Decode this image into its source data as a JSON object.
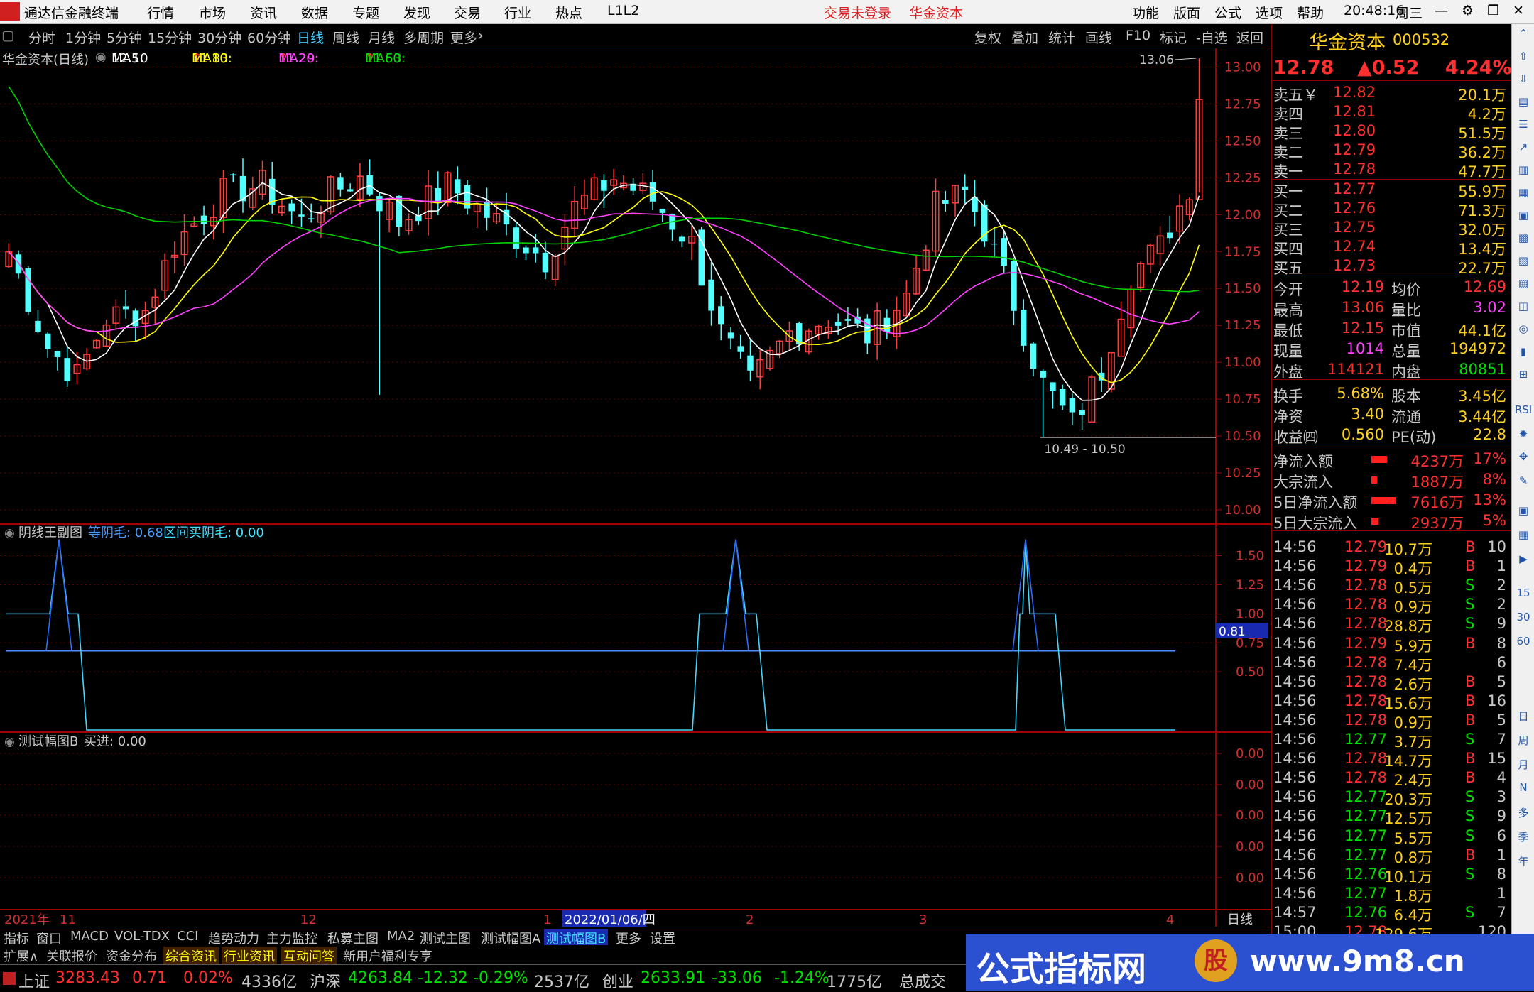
{
  "menubar": {
    "app_title": "通达信金融终端",
    "items": [
      "行情",
      "市场",
      "资讯",
      "数据",
      "专题",
      "发现",
      "交易",
      "行业",
      "热点",
      "L1L2"
    ],
    "notice": "交易未登录",
    "stock_name": "华金资本",
    "right_items": [
      "功能",
      "版面",
      "公式",
      "选项",
      "帮助"
    ],
    "time": "20:48:16",
    "weekday": "周三"
  },
  "periodbar": {
    "periods": [
      "分时",
      "1分钟",
      "5分钟",
      "15分钟",
      "30分钟",
      "60分钟",
      "日线",
      "周线",
      "月线",
      "多周期",
      "更多"
    ],
    "active": "日线",
    "right_tools": [
      "复权",
      "叠加",
      "统计",
      "画线",
      "F10",
      "标记",
      "-自选",
      "返回"
    ]
  },
  "main_chart": {
    "label": "华金资本(日线)",
    "ma": [
      {
        "label": "MA5:",
        "value": "12.10",
        "color": "#ffffff"
      },
      {
        "label": "MA10:",
        "value": "11.83",
        "color": "#ffff00"
      },
      {
        "label": "MA20:",
        "value": "11.29",
        "color": "#ff00ff"
      },
      {
        "label": "MA60:",
        "value": "11.53",
        "color": "#00ff00"
      }
    ],
    "high_label": "13.06",
    "low_label": "10.49 - 10.50",
    "y_ticks": [
      "13.00",
      "12.75",
      "12.50",
      "12.25",
      "12.00",
      "11.75",
      "11.50",
      "11.25",
      "11.00",
      "10.75",
      "10.50",
      "10.25",
      "10.00"
    ]
  },
  "sub1": {
    "label": "阴线王副图",
    "s1": "等阴毛: 0.68",
    "s2": "区间买阴毛: 0.00",
    "y_ticks": [
      "1.50",
      "1.25",
      "1.00",
      "0.75",
      "0.50"
    ],
    "cursor_value": "0.81"
  },
  "sub2": {
    "label": "测试幅图B",
    "s1": "买进: 0.00",
    "y_ticks": [
      "0.00",
      "0.00",
      "0.00",
      "0.00",
      "0.00"
    ]
  },
  "xaxis": {
    "labels": [
      "2021年",
      "11",
      "12",
      "1",
      "2022/01/06/四",
      "2",
      "3",
      "4"
    ],
    "right": "日线"
  },
  "chart_data": {
    "type": "candlestick",
    "y_range": [
      10.0,
      13.06
    ],
    "ma_values": {
      "MA5": 12.1,
      "MA10": 11.83,
      "MA20": 11.29,
      "MA60": 11.53
    },
    "period_high": 13.06,
    "period_low": 10.49
  },
  "quote": {
    "name": "华金资本",
    "code": "000532",
    "price": "12.78",
    "change": "▲0.52",
    "pct": "4.24%",
    "asks": [
      {
        "l": "卖五￥",
        "p": "12.82",
        "v": "20.1万"
      },
      {
        "l": "卖四",
        "p": "12.81",
        "v": "4.2万"
      },
      {
        "l": "卖三",
        "p": "12.80",
        "v": "51.5万"
      },
      {
        "l": "卖二",
        "p": "12.79",
        "v": "36.2万"
      },
      {
        "l": "卖一",
        "p": "12.78",
        "v": "47.7万"
      }
    ],
    "bids": [
      {
        "l": "买一",
        "p": "12.77",
        "v": "55.9万"
      },
      {
        "l": "买二",
        "p": "12.76",
        "v": "71.3万"
      },
      {
        "l": "买三",
        "p": "12.75",
        "v": "32.0万"
      },
      {
        "l": "买四",
        "p": "12.74",
        "v": "13.4万"
      },
      {
        "l": "买五",
        "p": "12.73",
        "v": "22.7万"
      }
    ],
    "stats": [
      [
        "今开",
        "12.19",
        "均价",
        "12.69"
      ],
      [
        "最高",
        "13.06",
        "量比",
        "3.02"
      ],
      [
        "最低",
        "12.15",
        "市值",
        "44.1亿"
      ],
      [
        "现量",
        "1014",
        "总量",
        "194972"
      ],
      [
        "外盘",
        "114121",
        "内盘",
        "80851"
      ],
      [
        "换手",
        "5.68%",
        "股本",
        "3.45亿"
      ],
      [
        "净资",
        "3.40",
        "流通",
        "3.44亿"
      ],
      [
        "收益㈣",
        "0.560",
        "PE(动)",
        "22.8"
      ]
    ],
    "flows": [
      [
        "净流入额",
        "4237万",
        "17%"
      ],
      [
        "大宗流入",
        "1887万",
        "8%"
      ],
      [
        "5日净流入额",
        "7616万",
        "13%"
      ],
      [
        "5日大宗流入",
        "2937万",
        "5%"
      ]
    ],
    "ticks": [
      [
        "14:56",
        "12.79",
        "10.7万",
        "B",
        "10"
      ],
      [
        "14:56",
        "12.79",
        "0.4万",
        "B",
        "1"
      ],
      [
        "14:56",
        "12.78",
        "0.5万",
        "S",
        "2"
      ],
      [
        "14:56",
        "12.78",
        "0.9万",
        "S",
        "2"
      ],
      [
        "14:56",
        "12.78",
        "28.8万",
        "S",
        "9"
      ],
      [
        "14:56",
        "12.79",
        "5.9万",
        "B",
        "8"
      ],
      [
        "14:56",
        "12.78",
        "7.4万",
        "",
        "6"
      ],
      [
        "14:56",
        "12.78",
        "2.6万",
        "B",
        "5"
      ],
      [
        "14:56",
        "12.78",
        "15.6万",
        "B",
        "16"
      ],
      [
        "14:56",
        "12.78",
        "0.9万",
        "B",
        "5"
      ],
      [
        "14:56",
        "12.77",
        "3.7万",
        "S",
        "7"
      ],
      [
        "14:56",
        "12.78",
        "14.7万",
        "B",
        "15"
      ],
      [
        "14:56",
        "12.78",
        "2.4万",
        "B",
        "4"
      ],
      [
        "14:56",
        "12.77",
        "20.3万",
        "S",
        "3"
      ],
      [
        "14:56",
        "12.77",
        "12.5万",
        "S",
        "9"
      ],
      [
        "14:56",
        "12.77",
        "5.5万",
        "S",
        "6"
      ],
      [
        "14:56",
        "12.77",
        "0.8万",
        "B",
        "1"
      ],
      [
        "14:56",
        "12.76",
        "10.1万",
        "S",
        "8"
      ],
      [
        "14:56",
        "12.77",
        "1.8万",
        "",
        "1"
      ],
      [
        "14:57",
        "12.76",
        "6.4万",
        "S",
        "7"
      ],
      [
        "15:00",
        "12.78",
        "129.6万",
        "",
        "120"
      ]
    ]
  },
  "rtool": [
    "60",
    "日",
    "周",
    "月",
    "N",
    "多",
    "季",
    "年",
    "15",
    "30",
    "RSI"
  ],
  "tabs": [
    "指标",
    "窗口",
    "MACD",
    "VOL-TDX",
    "CCI",
    "趋势动力",
    "主力监控",
    "私募主图",
    "MA2",
    "测试主图",
    "测试幅图A",
    "测试幅图B",
    "更多",
    "设置"
  ],
  "tabs2": [
    "扩展∧",
    "关联报价",
    "资金分布",
    "综合资讯",
    "行业资讯",
    "互动问答",
    "新用户福利专享"
  ],
  "status": [
    {
      "n": "上证",
      "v": "3283.43",
      "c": "0.71",
      "p": "0.02%",
      "a": "4336亿"
    },
    {
      "n": "沪深",
      "v": "4263.84",
      "c": "-12.32",
      "p": "-0.29%",
      "a": "2537亿"
    },
    {
      "n": "创业",
      "v": "2633.91",
      "c": "-33.06",
      "p": "-1.24%",
      "a": "1775亿"
    }
  ],
  "status_tail": "总成交",
  "banner": {
    "text": "公式指标网",
    "url": "www.9m8.cn",
    "logo": "股"
  }
}
